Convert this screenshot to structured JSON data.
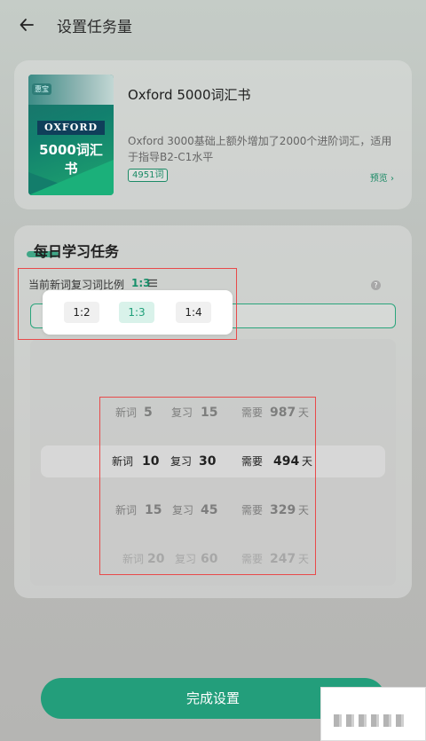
{
  "header": {
    "title": "设置任务量"
  },
  "book": {
    "cover_tag": "惠宝",
    "cover_brand": "OXFORD",
    "cover_title": "5000词汇书",
    "name": "Oxford 5000词汇书",
    "description": "Oxford 3000基础上额外增加了2000个进阶词汇，适用于指导B2-C1水平",
    "word_count": "4951词",
    "preview_label": "预览 ›"
  },
  "task": {
    "section_title": "每日学习任务",
    "ratio_label": "当前新词复习词比例",
    "ratio_value": "1:3",
    "help_icon": "?"
  },
  "ratio_popup": {
    "options": [
      {
        "label": "1:2",
        "selected": false
      },
      {
        "label": "1:3",
        "selected": true
      },
      {
        "label": "1:4",
        "selected": false
      }
    ]
  },
  "wheel": {
    "rows": [
      {
        "new_label": "新词",
        "new": "5",
        "review_label": "复习",
        "review": "15",
        "need_label": "需要",
        "days": "987",
        "unit": "天"
      },
      {
        "new_label": "新词",
        "new": "10",
        "review_label": "复习",
        "review": "30",
        "need_label": "需要",
        "days": "494",
        "unit": "天"
      },
      {
        "new_label": "新词",
        "new": "15",
        "review_label": "复习",
        "review": "45",
        "need_label": "需要",
        "days": "329",
        "unit": "天"
      },
      {
        "new_label": "新词",
        "new": "20",
        "review_label": "复习",
        "review": "60",
        "need_label": "需要",
        "days": "247",
        "unit": "天"
      }
    ],
    "selected_index": 1
  },
  "footer": {
    "done_label": "完成设置"
  },
  "colors": {
    "accent": "#239e7b",
    "highlight_box": "#e84a4a"
  }
}
